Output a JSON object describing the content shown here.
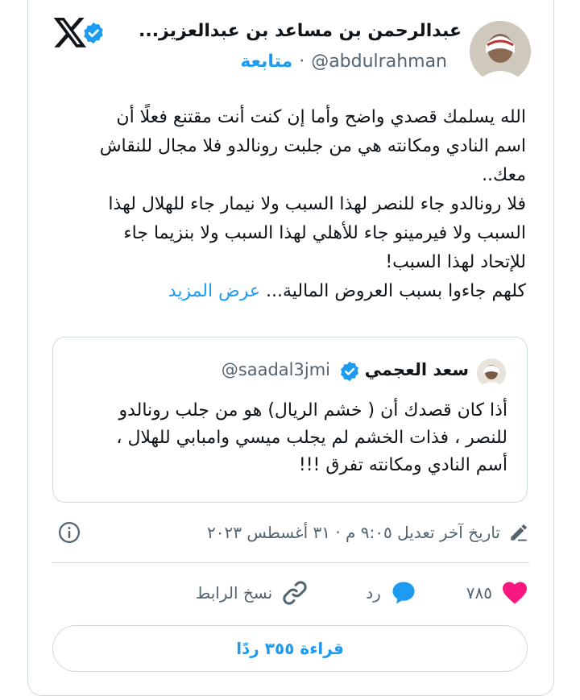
{
  "header": {
    "author_name": "عبدالرحمن بن مساعد بن عبدالعزيز...",
    "handle": "@abdulrahman",
    "separator": "·",
    "follow_label": "متابعة"
  },
  "body": {
    "lines": [
      "الله يسلمك قصدي واضح وأما إن كنت أنت مقتنع فعلًا  أن",
      "اسم النادي ومكانته هي من جلبت رونالدو فلا مجال للنقاش",
      "معك..",
      "فلا رونالدو جاء للنصر لهذا السبب ولا نيمار جاء للهلال لهذا",
      "السبب ولا فيرمينو جاء للأهلي لهذا السبب ولا بنزيما جاء",
      "للإتحاد لهذا السبب!"
    ],
    "last_line": "كلهم جاءوا بسبب العروض المالية...",
    "show_more": "عرض المزيد"
  },
  "quote": {
    "name": "سعد العجمي",
    "handle": "@saadal3jmi",
    "lines": [
      "أذا كان قصدك أن ( خشم الريال) هو من جلب رونالدو",
      "للنصر ، فذات الخشم لم يجلب ميسي وامبابي للهلال ،",
      "أسم النادي ومكانته  تفرق !!!"
    ]
  },
  "meta": {
    "edited_text": "تاريخ آخر تعديل ٩:٠٥ م · ٣١ أغسطس ٢٠٢٣"
  },
  "actions": {
    "like_count": "٧٨٥",
    "reply_label": "رد",
    "copy_link_label": "نسخ الرابط"
  },
  "read_replies": "قراءة ٣٥٥ ردًا",
  "colors": {
    "accent": "#1d9bf0",
    "like": "#f91880",
    "text": "#0f1419",
    "muted": "#536471",
    "border": "#cfd9de"
  }
}
